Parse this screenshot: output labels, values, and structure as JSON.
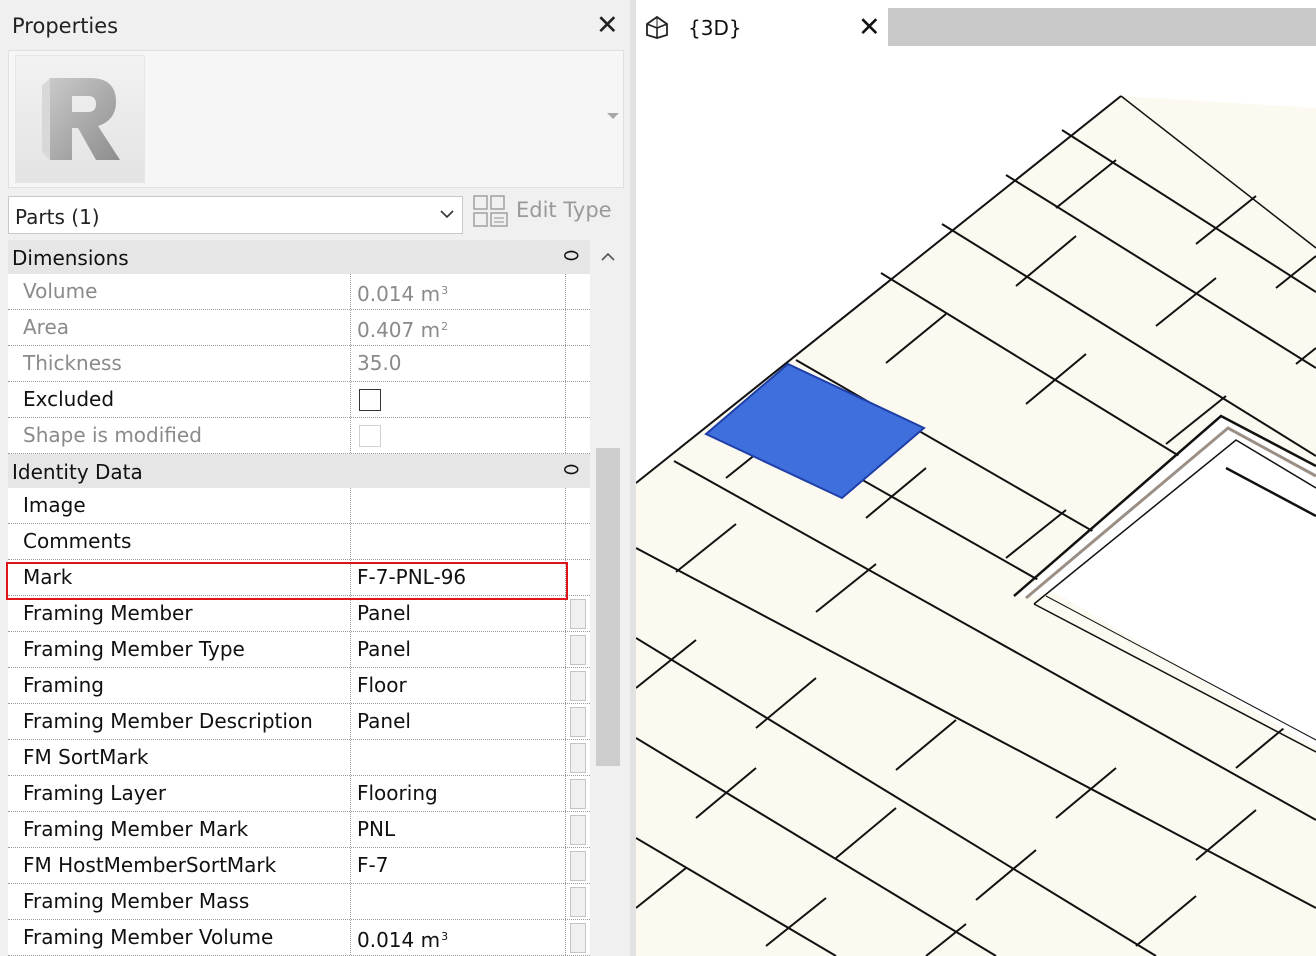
{
  "properties": {
    "title": "Properties",
    "close_glyph": "✕",
    "type_icon": "revit-r-logo-icon",
    "selector_label": "Parts (1)",
    "edit_type_label": "Edit Type",
    "groups": [
      {
        "label": "Dimensions",
        "collapse_glyph": "⬭",
        "rows": [
          {
            "name": "Volume",
            "value": "0.014 m",
            "unit_sup": "3",
            "read_only": true
          },
          {
            "name": "Area",
            "value": "0.407 m",
            "unit_sup": "2",
            "read_only": true
          },
          {
            "name": "Thickness",
            "value": "35.0",
            "read_only": true
          },
          {
            "name": "Excluded",
            "checkbox": true,
            "checked": false,
            "read_only": false
          },
          {
            "name": "Shape is modified",
            "checkbox": true,
            "checked": false,
            "read_only": true
          }
        ]
      },
      {
        "label": "Identity Data",
        "collapse_glyph": "⬭",
        "rows": [
          {
            "name": "Image",
            "value": ""
          },
          {
            "name": "Comments",
            "value": ""
          },
          {
            "name": "Mark",
            "value": "F-7-PNL-96"
          },
          {
            "name": "Framing Member",
            "value": "Panel",
            "has_button": true
          },
          {
            "name": "Framing Member Type",
            "value": "Panel",
            "has_button": true
          },
          {
            "name": "Framing",
            "value": "Floor",
            "has_button": true
          },
          {
            "name": "Framing Member Description",
            "value": "Panel",
            "has_button": true
          },
          {
            "name": "FM SortMark",
            "value": "",
            "has_button": true
          },
          {
            "name": "Framing Layer",
            "value": "Flooring",
            "has_button": true
          },
          {
            "name": "Framing Member Mark",
            "value": "PNL",
            "has_button": true
          },
          {
            "name": "FM HostMemberSortMark",
            "value": "F-7",
            "has_button": true
          },
          {
            "name": "Framing Member Mass",
            "value": "",
            "has_button": true
          },
          {
            "name": "Framing Member Volume",
            "value": "0.014 m",
            "unit_sup": "3",
            "has_button": true
          }
        ]
      }
    ]
  },
  "view_tab": {
    "title": "{3D}",
    "icon": "3d-view-house-icon",
    "close_glyph": "✕"
  },
  "colors": {
    "selected_panel": "#3f6fdc",
    "highlight_border": "#e0151c",
    "panel_fill": "#fbf9f0"
  }
}
